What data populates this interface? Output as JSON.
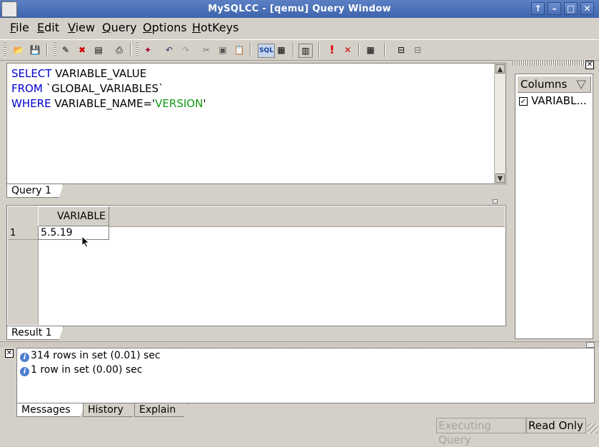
{
  "window": {
    "title": "MySQLCC - [qemu] Query Window",
    "btn_up": "↑",
    "btn_min": "–",
    "btn_max": "□",
    "btn_close": "✕"
  },
  "menu": [
    {
      "key": "F",
      "rest": "ile"
    },
    {
      "key": "E",
      "rest": "dit"
    },
    {
      "key": "V",
      "rest": "iew"
    },
    {
      "key": "Q",
      "rest": "uery"
    },
    {
      "key": "O",
      "rest": "ptions"
    },
    {
      "key": "H",
      "rest": "otKeys"
    }
  ],
  "editor": {
    "lines": [
      {
        "keyword": "SELECT",
        "rest": " VARIABLE_VALUE",
        "string": "",
        "tail": ""
      },
      {
        "keyword": "FROM",
        "rest": " `GLOBAL_VARIABLES`",
        "string": "",
        "tail": ""
      },
      {
        "keyword": "WHERE",
        "rest": " VARIABLE_NAME='",
        "string": "VERSION",
        "tail": "'"
      }
    ],
    "tab_label": "Query 1"
  },
  "result": {
    "column_header": "VARIABLE",
    "row_number": "1",
    "cell_value": "5.5.19",
    "tab_label": "Result 1"
  },
  "columns_panel": {
    "header": "Columns",
    "item_label": "VARIABL...",
    "check": "✓"
  },
  "messages": {
    "items": [
      "314 rows in set (0.01) sec",
      "1 row in set (0.00) sec"
    ],
    "tabs": [
      "Messages",
      "History",
      "Explain"
    ]
  },
  "status": {
    "executing": "Executing Query",
    "readonly": "Read Only"
  },
  "icons": {
    "open": "📂",
    "save": "💾",
    "new": "✎",
    "delete": "✖",
    "copy_tbl": "▤",
    "print": "⎙",
    "wand": "✦",
    "undo": "↶",
    "redo": "↷",
    "cut": "✂",
    "copy": "▣",
    "paste": "📋",
    "sql": "SQL",
    "grid": "▦",
    "panel": "▥",
    "exec": "!",
    "stop": "✕",
    "table": "▦",
    "tree": "⊟"
  },
  "colors": {
    "keyword": "#0000cc",
    "string": "#119911",
    "titlebar": "#3d64ad"
  }
}
